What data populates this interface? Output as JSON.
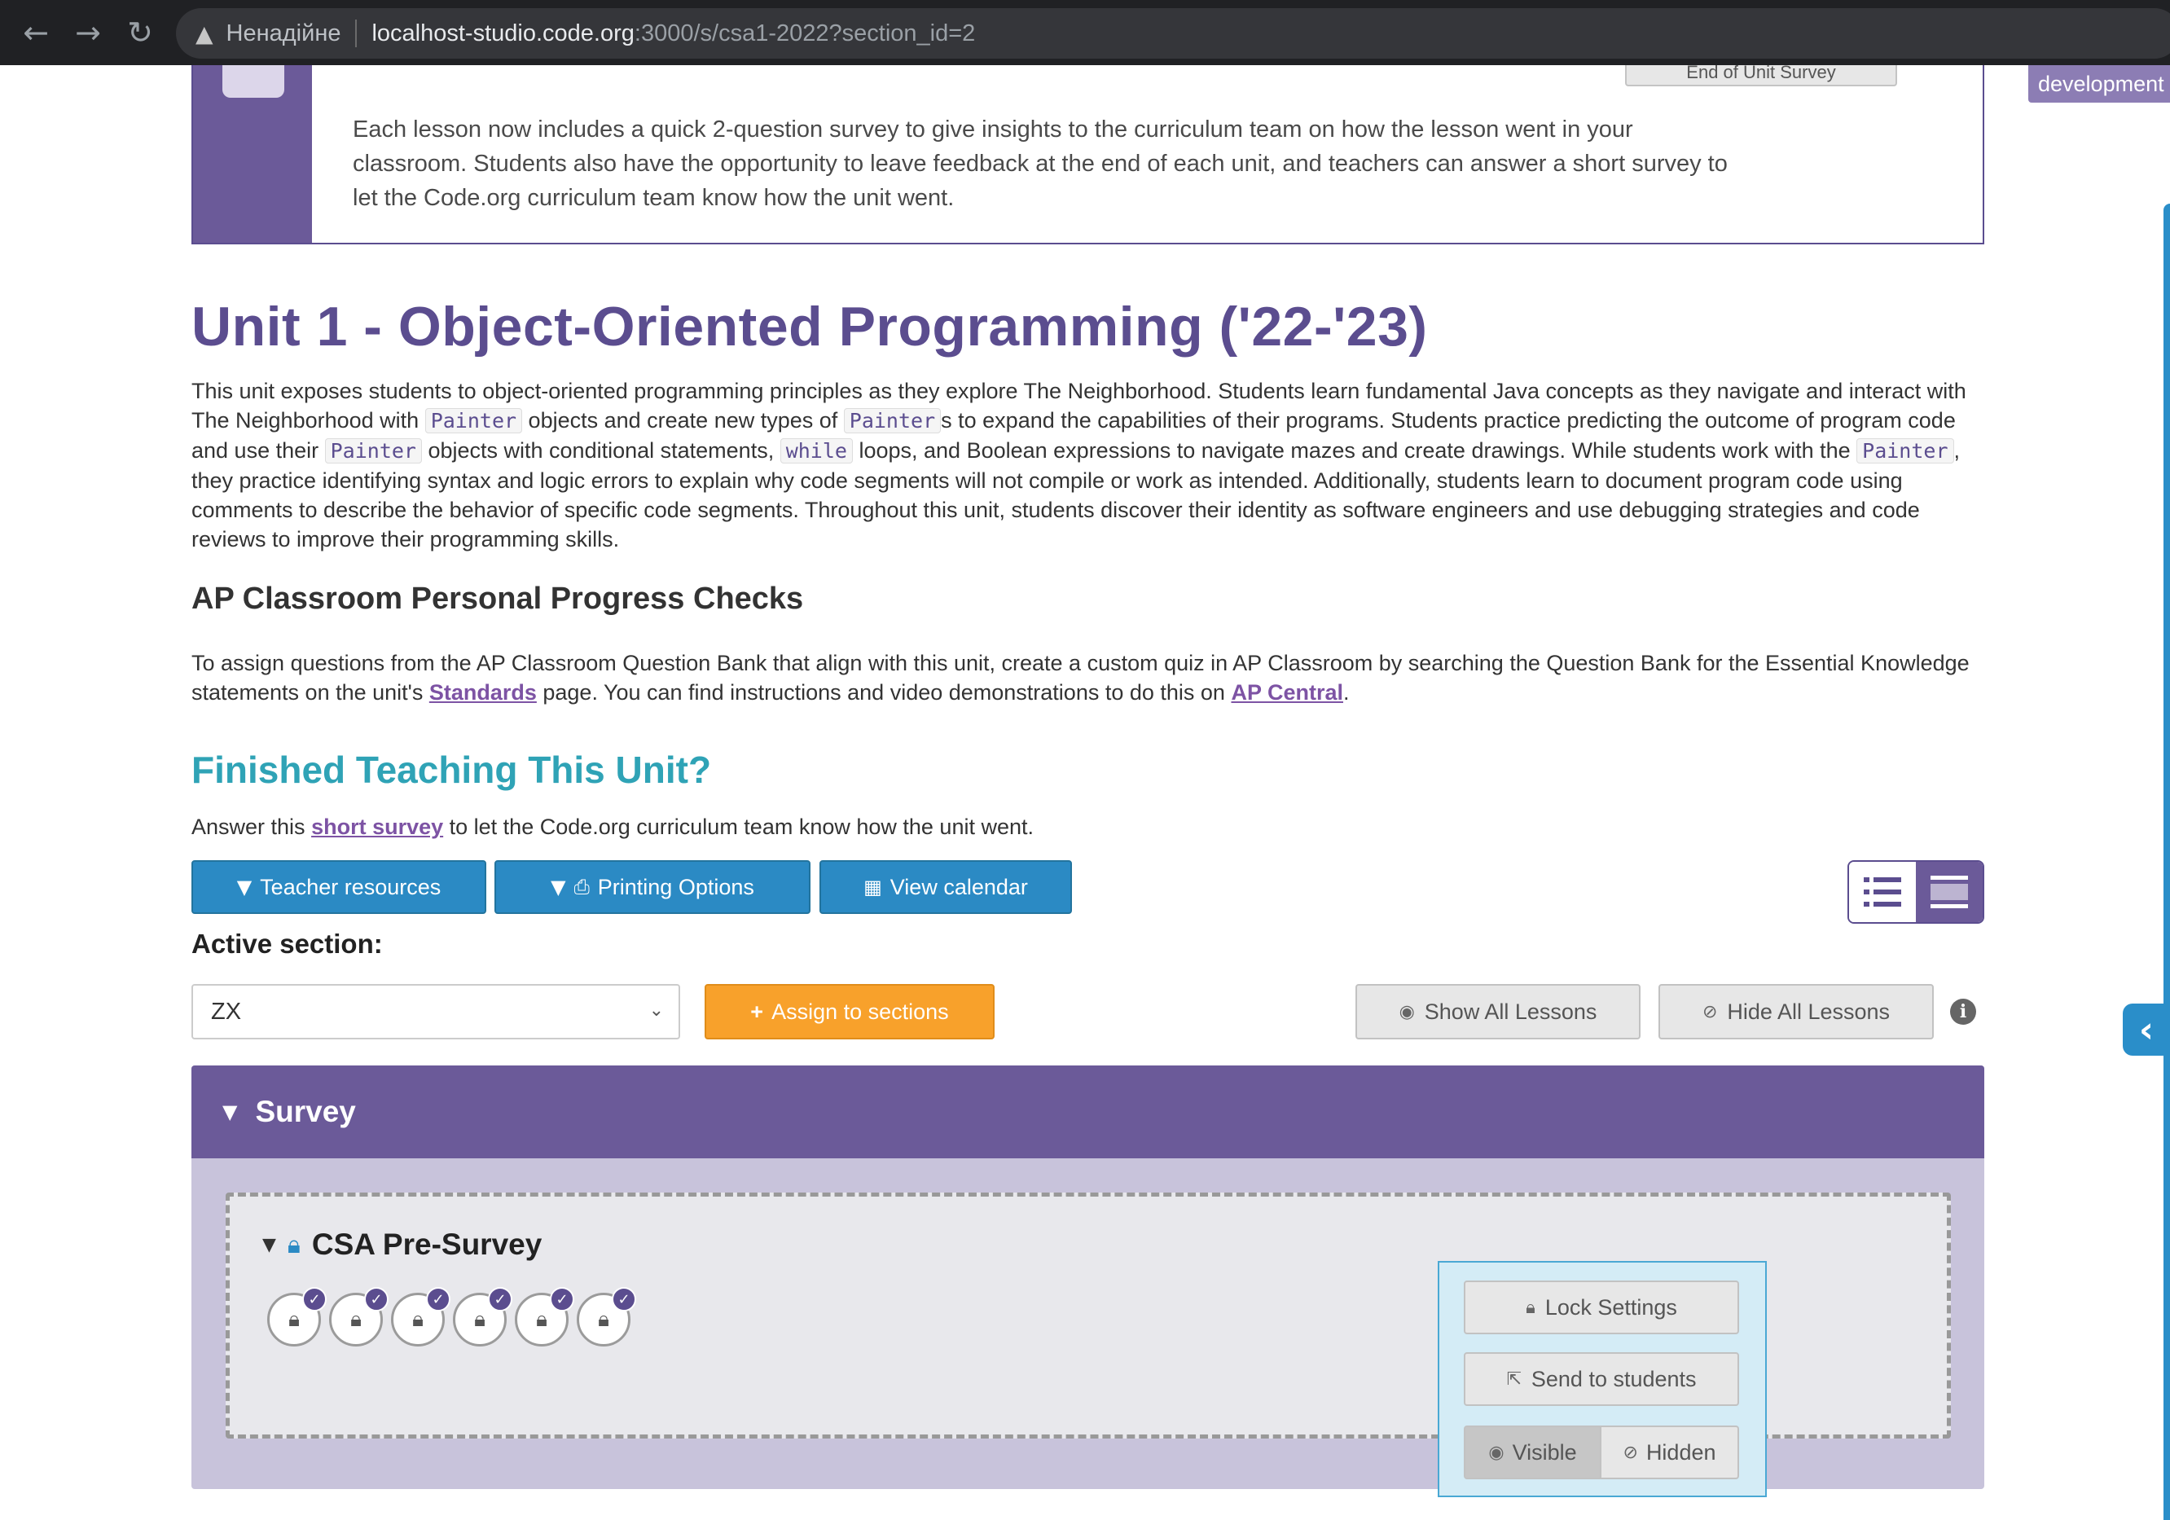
{
  "browser": {
    "insecure_label": "Ненадійне",
    "url_host": "localhost-studio.code.org",
    "url_path": ":3000/s/csa1-2022?section_id=2"
  },
  "dev_badge": "development",
  "notice": {
    "button_label": "End of Unit Survey",
    "text": "Each lesson now includes a quick 2-question survey to give insights to the curriculum team on how the lesson went in your classroom. Students also have the opportunity to leave feedback at the end of each unit, and teachers can answer a short survey to let the Code.org curriculum team know how the unit went."
  },
  "unit": {
    "title": "Unit 1 - Object-Oriented Programming ('22-'23)",
    "desc_1": "This unit exposes students to object-oriented programming principles as they explore The Neighborhood. Students learn fundamental Java concepts as they navigate and interact with The Neighborhood with ",
    "code_painter": "Painter",
    "desc_2": " objects and create new types of ",
    "desc_3": "s to expand the capabilities of their programs. Students practice predicting the outcome of program code and use their ",
    "desc_4": " objects with conditional statements, ",
    "code_while": "while",
    "desc_5": " loops, and Boolean expressions to navigate mazes and create drawings. While students work with the ",
    "desc_6": ", they practice identifying syntax and logic errors to explain why code segments will not compile or work as intended. Additionally, students learn to document program code using comments to describe the behavior of specific code segments. Throughout this unit, students discover their identity as software engineers and use debugging strategies and code reviews to improve their programming skills."
  },
  "ap": {
    "heading": "AP Classroom Personal Progress Checks",
    "text_1": "To assign questions from the AP Classroom Question Bank that align with this unit, create a custom quiz in AP Classroom by searching the Question Bank for the Essential Knowledge statements on the unit's ",
    "standards_link": "Standards",
    "text_2": " page. You can find instructions and video demonstrations to do this on ",
    "ap_central_link": "AP Central",
    "text_3": "."
  },
  "finished": {
    "heading": "Finished Teaching This Unit?",
    "text_1": "Answer this ",
    "survey_link": "short survey",
    "text_2": " to let the Code.org curriculum team know how the unit went."
  },
  "toolbar": {
    "teacher_resources": "Teacher resources",
    "printing_options": "Printing Options",
    "view_calendar": "View calendar"
  },
  "section": {
    "active_label": "Active section:",
    "selected": "ZX",
    "assign_button": "Assign to sections",
    "show_all": "Show All Lessons",
    "hide_all": "Hide All Lessons"
  },
  "survey_group": {
    "title": "Survey",
    "lesson": {
      "name": "CSA Pre-Survey",
      "bubble_count": 6
    }
  },
  "lock_panel": {
    "lock_settings": "Lock Settings",
    "send_to_students": "Send to students",
    "visible": "Visible",
    "hidden": "Hidden"
  },
  "colors": {
    "brand_purple": "#5b4d8f",
    "header_purple": "#6b5a99",
    "teal_heading": "#2fa3b6",
    "button_blue": "#2b8ac4",
    "button_orange": "#f8a12b"
  }
}
